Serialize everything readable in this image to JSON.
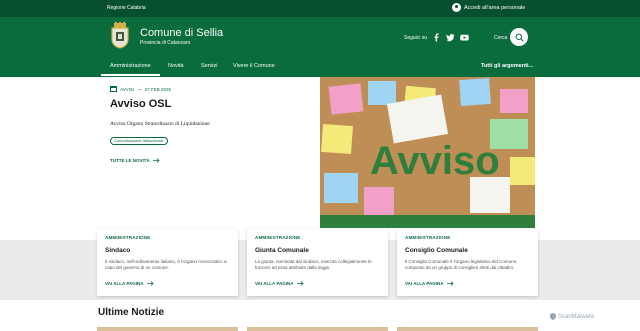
{
  "topbar": {
    "region": "Regione Calabria",
    "login": "Accedi all'area personale"
  },
  "header": {
    "title": "Comune di Sellia",
    "subtitle": "Provincia di Catanzaro",
    "social_label": "Seguici su",
    "search_label": "Cerca",
    "social_icons": [
      "facebook-icon",
      "twitter-icon",
      "youtube-icon"
    ]
  },
  "nav": {
    "items": [
      "Amministrazione",
      "Novità",
      "Servizi",
      "Vivere il Comune"
    ],
    "all": "Tutti gli argomenti..."
  },
  "hero": {
    "category": "AVVISI",
    "separator": "—",
    "date": "27 FEB 2026",
    "title": "Avviso OSL",
    "description": "Avviso Organo Straordinario di Liquidazione",
    "chip": "Comunicazione istituzionale",
    "all_news": "TUTTE LE NOVITÀ",
    "image_text": "Avviso"
  },
  "cards": [
    {
      "category": "AMMINISTRAZIONE",
      "title": "Sindaco",
      "description": "Il sindaco, nell'ordinamento italiano, è l'organo monocratico a capo del governo di un comune.",
      "link": "VAI ALLA PAGINA"
    },
    {
      "category": "AMMINISTRAZIONE",
      "title": "Giunta Comunale",
      "description": "La giunta, nominata dal sindaco, esercita collegialmente le funzioni ad essa attribuite dalla legge.",
      "link": "VAI ALLA PAGINA"
    },
    {
      "category": "AMMINISTRAZIONE",
      "title": "Consiglio Comunale",
      "description": "Il Consiglio Comunale è l'organo legislativo del Comune, composto da un gruppo di consiglieri eletti dai cittadini.",
      "link": "VAI ALLA PAGINA"
    }
  ],
  "news": {
    "title": "Ultime Notizie"
  },
  "watermark": "ScanMalware",
  "colors": {
    "brand": "#0a6b3d",
    "topbar": "#06502f"
  }
}
